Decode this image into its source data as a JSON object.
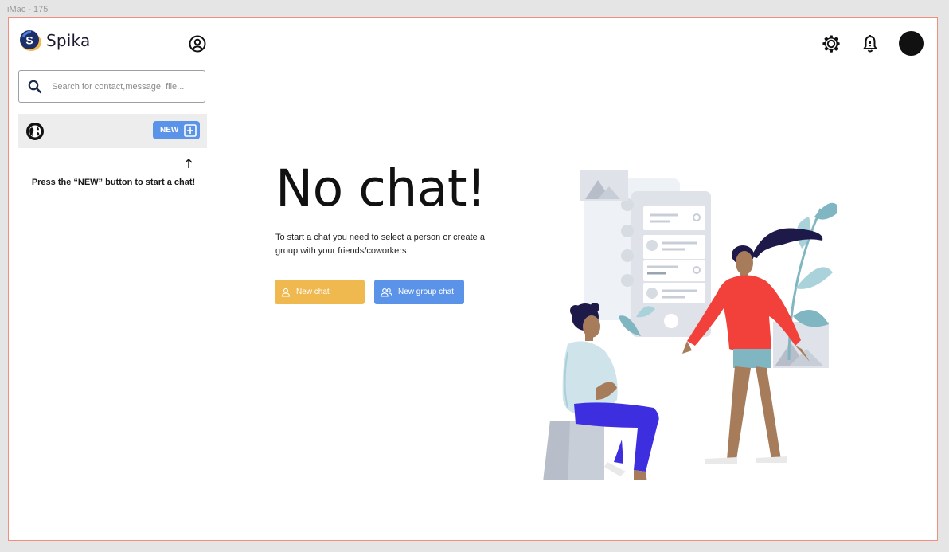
{
  "frame_label": "iMac - 175",
  "app": {
    "name": "Spika"
  },
  "sidebar": {
    "search": {
      "placeholder": "Search for contact,message, file..."
    },
    "new_button_label": "NEW",
    "hint": "Press the “NEW” button to start a chat!"
  },
  "header": {
    "icons": [
      "gear-icon",
      "bell-icon",
      "avatar"
    ]
  },
  "main": {
    "title": "No chat!",
    "subtitle": "To start a chat you need to select a person or create a group with your friends/coworkers",
    "new_chat_label": "New chat",
    "new_group_chat_label": "New group chat"
  },
  "colors": {
    "accent_blue": "#5b93e9",
    "accent_yellow": "#efb94f",
    "frame_border": "#f08f80"
  }
}
